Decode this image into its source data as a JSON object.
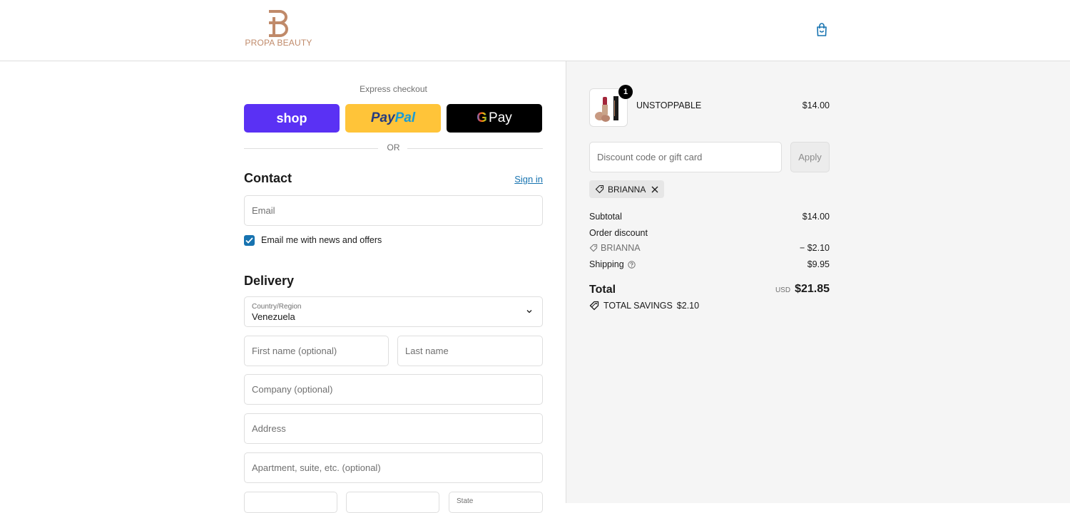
{
  "brand": {
    "name": "PROPA BEAUTY",
    "accent": "#c08a6a"
  },
  "header": {
    "cart_icon": "shopping-bag-icon"
  },
  "express": {
    "label": "Express checkout",
    "shop_label": "shop",
    "paypal_label_1": "Pay",
    "paypal_label_2": "Pal",
    "gpay_g": "G",
    "gpay_label": "Pay",
    "or": "OR"
  },
  "contact": {
    "title": "Contact",
    "sign_in": "Sign in",
    "email_placeholder": "Email",
    "news_label": "Email me with news and offers",
    "news_checked": true
  },
  "delivery": {
    "title": "Delivery",
    "country_label": "Country/Region",
    "country_value": "Venezuela",
    "first_name_placeholder": "First name (optional)",
    "last_name_placeholder": "Last name",
    "company_placeholder": "Company (optional)",
    "address_placeholder": "Address",
    "apartment_placeholder": "Apartment, suite, etc. (optional)",
    "state_label": "State"
  },
  "summary": {
    "product": {
      "name": "UNSTOPPABLE",
      "price": "$14.00",
      "quantity": "1"
    },
    "discount_placeholder": "Discount code or gift card",
    "apply_label": "Apply",
    "applied_code": "BRIANNA",
    "subtotal_label": "Subtotal",
    "subtotal_value": "$14.00",
    "order_discount_label": "Order discount",
    "discount_code": "BRIANNA",
    "discount_value": "− $2.10",
    "shipping_label": "Shipping",
    "shipping_value": "$9.95",
    "total_label": "Total",
    "currency": "USD",
    "total_value": "$21.85",
    "savings_label": "TOTAL SAVINGS",
    "savings_value": "$2.10"
  }
}
